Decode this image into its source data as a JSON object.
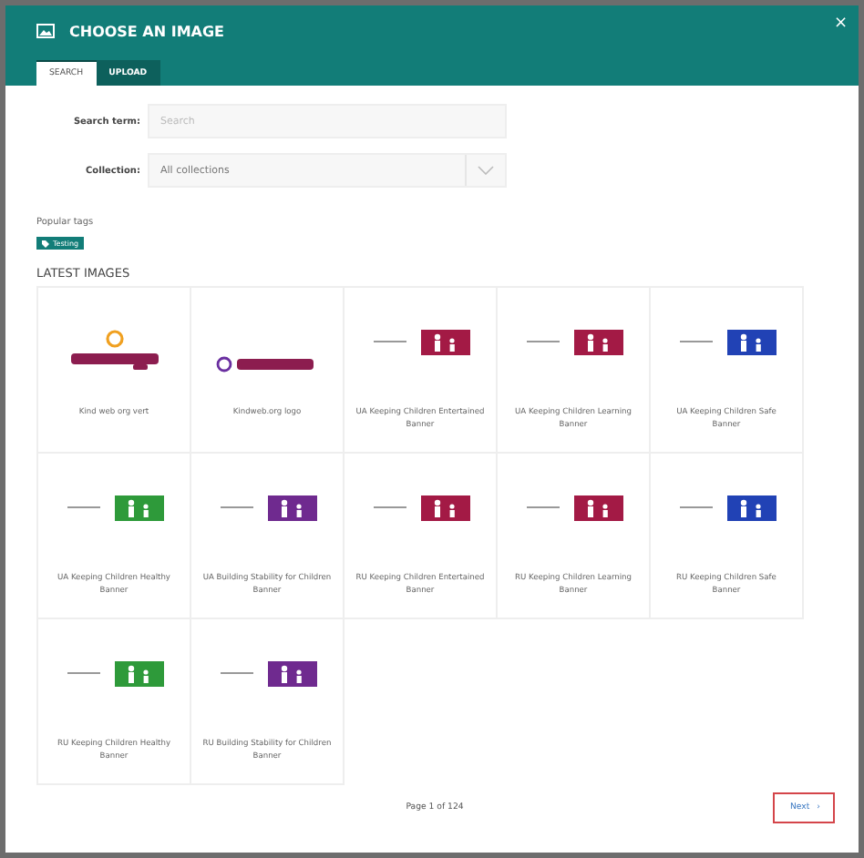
{
  "dialog": {
    "title": "CHOOSE AN IMAGE",
    "close": "×"
  },
  "tabs": [
    {
      "label": "SEARCH",
      "selected": true
    },
    {
      "label": "UPLOAD",
      "selected": false
    }
  ],
  "search": {
    "label": "Search term:",
    "placeholder": "Search"
  },
  "collection": {
    "label": "Collection:",
    "value": "All collections"
  },
  "popular_tags": {
    "label": "Popular tags",
    "tags": [
      "Testing"
    ]
  },
  "latest_images": {
    "heading": "LATEST IMAGES",
    "items": [
      {
        "title": "Kind web org vert",
        "kind": "picture"
      },
      {
        "title": "Kindweb.org logo",
        "kind": "picture"
      },
      {
        "title": "UA Keeping Children Entertained Banner",
        "kind": "picture"
      },
      {
        "title": "UA Keeping Children Learning Banner",
        "kind": "picture"
      },
      {
        "title": "UA Keeping Children Safe Banner",
        "kind": "picture"
      },
      {
        "title": "UA Keeping Children Healthy Banner",
        "kind": "picture"
      },
      {
        "title": "UA Building Stability for Children Banner",
        "kind": "picture"
      },
      {
        "title": "RU Keeping Children Entertained Banner",
        "kind": "picture"
      },
      {
        "title": "RU Keeping Children Learning Banner",
        "kind": "picture"
      },
      {
        "title": "RU Keeping Children Safe Banner",
        "kind": "picture"
      },
      {
        "title": "RU Keeping Children Healthy Banner",
        "kind": "picture"
      },
      {
        "title": "RU Building Stability for Children Banner",
        "kind": "picture"
      }
    ]
  },
  "pagination": {
    "status": "Page 1 of 124",
    "next": "Next",
    "next_chevron": "›"
  }
}
